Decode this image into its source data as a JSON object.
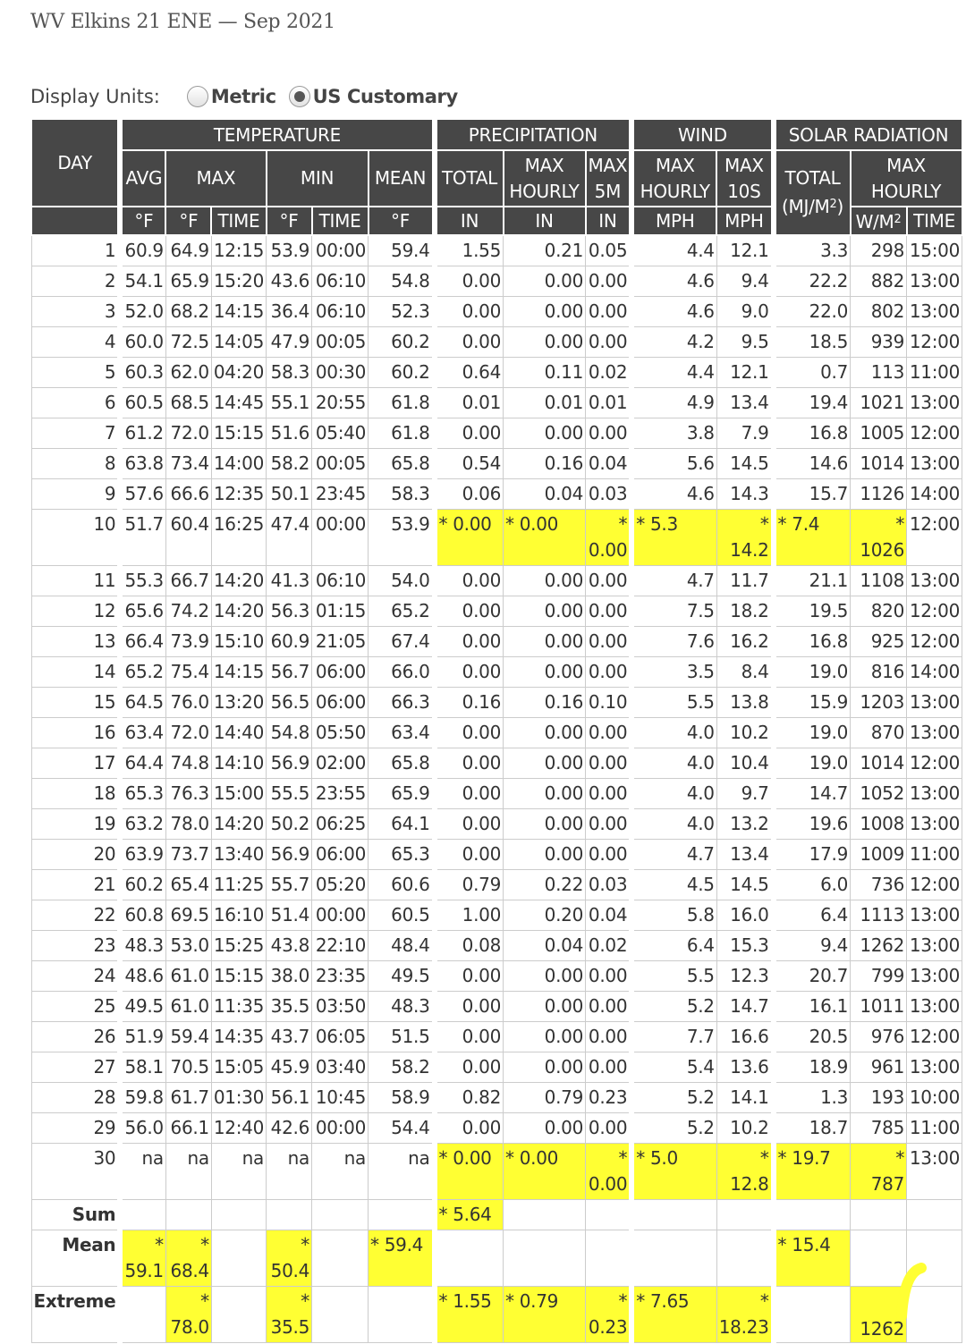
{
  "title": "WV Elkins 21 ENE — Sep 2021",
  "display_units": {
    "label": "Display Units:",
    "options": [
      "Metric",
      "US Customary"
    ],
    "selected": "US Customary"
  },
  "header": {
    "day": "DAY",
    "groups": [
      "TEMPERATURE",
      "PRECIPITATION",
      "WIND",
      "SOLAR RADIATION"
    ],
    "sub": {
      "avg": "AVG",
      "max": "MAX",
      "min": "MIN",
      "mean": "MEAN",
      "total": "TOTAL",
      "max_hourly_1": "MAX",
      "max_hourly_2": "HOURLY",
      "max5m_1": "MAX",
      "max5m_2": "5M",
      "wmax_hourly_1": "MAX",
      "wmax_hourly_2": "HOURLY",
      "max10s_1": "MAX",
      "max10s_2": "10S",
      "sol_total_1": "TOTAL",
      "sol_total_2": "(MJ/M",
      "sol_max_1": "MAX",
      "sol_max_2": "HOURLY"
    },
    "units": {
      "degf": "°F",
      "time": "TIME",
      "in": "IN",
      "mph": "MPH",
      "wm2": "W/M",
      "sup2": "2"
    }
  },
  "rows": [
    [
      "1",
      "60.9",
      "64.9",
      "12:15",
      "53.9",
      "00:00",
      "59.4",
      "1.55",
      "0.21",
      "0.05",
      "4.4",
      "12.1",
      "3.3",
      "298",
      "15:00"
    ],
    [
      "2",
      "54.1",
      "65.9",
      "15:20",
      "43.6",
      "06:10",
      "54.8",
      "0.00",
      "0.00",
      "0.00",
      "4.6",
      "9.4",
      "22.2",
      "882",
      "13:00"
    ],
    [
      "3",
      "52.0",
      "68.2",
      "14:15",
      "36.4",
      "06:10",
      "52.3",
      "0.00",
      "0.00",
      "0.00",
      "4.6",
      "9.0",
      "22.0",
      "802",
      "13:00"
    ],
    [
      "4",
      "60.0",
      "72.5",
      "14:05",
      "47.9",
      "00:05",
      "60.2",
      "0.00",
      "0.00",
      "0.00",
      "4.2",
      "9.5",
      "18.5",
      "939",
      "12:00"
    ],
    [
      "5",
      "60.3",
      "62.0",
      "04:20",
      "58.3",
      "00:30",
      "60.2",
      "0.64",
      "0.11",
      "0.02",
      "4.4",
      "12.1",
      "0.7",
      "113",
      "11:00"
    ],
    [
      "6",
      "60.5",
      "68.5",
      "14:45",
      "55.1",
      "20:55",
      "61.8",
      "0.01",
      "0.01",
      "0.01",
      "4.9",
      "13.4",
      "19.4",
      "1021",
      "13:00"
    ],
    [
      "7",
      "61.2",
      "72.0",
      "15:15",
      "51.6",
      "05:40",
      "61.8",
      "0.00",
      "0.00",
      "0.00",
      "3.8",
      "7.9",
      "16.8",
      "1005",
      "12:00"
    ],
    [
      "8",
      "63.8",
      "73.4",
      "14:00",
      "58.2",
      "00:05",
      "65.8",
      "0.54",
      "0.16",
      "0.04",
      "5.6",
      "14.5",
      "14.6",
      "1014",
      "13:00"
    ],
    [
      "9",
      "57.6",
      "66.6",
      "12:35",
      "50.1",
      "23:45",
      "58.3",
      "0.06",
      "0.04",
      "0.03",
      "4.6",
      "14.3",
      "15.7",
      "1126",
      "14:00"
    ],
    [
      "10",
      "51.7",
      "60.4",
      "16:25",
      "47.4",
      "00:00",
      "53.9",
      "* 0.00",
      "* 0.00",
      "* 0.00",
      "* 5.3",
      "* 14.2",
      "* 7.4",
      "* 1026",
      "12:00"
    ],
    [
      "11",
      "55.3",
      "66.7",
      "14:20",
      "41.3",
      "06:10",
      "54.0",
      "0.00",
      "0.00",
      "0.00",
      "4.7",
      "11.7",
      "21.1",
      "1108",
      "13:00"
    ],
    [
      "12",
      "65.6",
      "74.2",
      "14:20",
      "56.3",
      "01:15",
      "65.2",
      "0.00",
      "0.00",
      "0.00",
      "7.5",
      "18.2",
      "19.5",
      "820",
      "12:00"
    ],
    [
      "13",
      "66.4",
      "73.9",
      "15:10",
      "60.9",
      "21:05",
      "67.4",
      "0.00",
      "0.00",
      "0.00",
      "7.6",
      "16.2",
      "16.8",
      "925",
      "12:00"
    ],
    [
      "14",
      "65.2",
      "75.4",
      "14:15",
      "56.7",
      "06:00",
      "66.0",
      "0.00",
      "0.00",
      "0.00",
      "3.5",
      "8.4",
      "19.0",
      "816",
      "14:00"
    ],
    [
      "15",
      "64.5",
      "76.0",
      "13:20",
      "56.5",
      "06:00",
      "66.3",
      "0.16",
      "0.16",
      "0.10",
      "5.5",
      "13.8",
      "15.9",
      "1203",
      "13:00"
    ],
    [
      "16",
      "63.4",
      "72.0",
      "14:40",
      "54.8",
      "05:50",
      "63.4",
      "0.00",
      "0.00",
      "0.00",
      "4.0",
      "10.2",
      "19.0",
      "870",
      "13:00"
    ],
    [
      "17",
      "64.4",
      "74.8",
      "14:10",
      "56.9",
      "02:00",
      "65.8",
      "0.00",
      "0.00",
      "0.00",
      "4.0",
      "10.4",
      "19.0",
      "1014",
      "12:00"
    ],
    [
      "18",
      "65.3",
      "76.3",
      "15:00",
      "55.5",
      "23:55",
      "65.9",
      "0.00",
      "0.00",
      "0.00",
      "4.0",
      "9.7",
      "14.7",
      "1052",
      "13:00"
    ],
    [
      "19",
      "63.2",
      "78.0",
      "14:20",
      "50.2",
      "06:25",
      "64.1",
      "0.00",
      "0.00",
      "0.00",
      "4.0",
      "13.2",
      "19.6",
      "1008",
      "13:00"
    ],
    [
      "20",
      "63.9",
      "73.7",
      "13:40",
      "56.9",
      "06:00",
      "65.3",
      "0.00",
      "0.00",
      "0.00",
      "4.7",
      "13.4",
      "17.9",
      "1009",
      "11:00"
    ],
    [
      "21",
      "60.2",
      "65.4",
      "11:25",
      "55.7",
      "05:20",
      "60.6",
      "0.79",
      "0.22",
      "0.03",
      "4.5",
      "14.5",
      "6.0",
      "736",
      "12:00"
    ],
    [
      "22",
      "60.8",
      "69.5",
      "16:10",
      "51.4",
      "00:00",
      "60.5",
      "1.00",
      "0.20",
      "0.04",
      "5.8",
      "16.0",
      "6.4",
      "1113",
      "13:00"
    ],
    [
      "23",
      "48.3",
      "53.0",
      "15:25",
      "43.8",
      "22:10",
      "48.4",
      "0.08",
      "0.04",
      "0.02",
      "6.4",
      "15.3",
      "9.4",
      "1262",
      "13:00"
    ],
    [
      "24",
      "48.6",
      "61.0",
      "15:15",
      "38.0",
      "23:35",
      "49.5",
      "0.00",
      "0.00",
      "0.00",
      "5.5",
      "12.3",
      "20.7",
      "799",
      "13:00"
    ],
    [
      "25",
      "49.5",
      "61.0",
      "11:35",
      "35.5",
      "03:50",
      "48.3",
      "0.00",
      "0.00",
      "0.00",
      "5.2",
      "14.7",
      "16.1",
      "1011",
      "13:00"
    ],
    [
      "26",
      "51.9",
      "59.4",
      "14:35",
      "43.7",
      "06:05",
      "51.5",
      "0.00",
      "0.00",
      "0.00",
      "7.7",
      "16.6",
      "20.5",
      "976",
      "12:00"
    ],
    [
      "27",
      "58.1",
      "70.5",
      "15:05",
      "45.9",
      "03:40",
      "58.2",
      "0.00",
      "0.00",
      "0.00",
      "5.4",
      "13.6",
      "18.9",
      "961",
      "13:00"
    ],
    [
      "28",
      "59.8",
      "61.7",
      "01:30",
      "56.1",
      "10:45",
      "58.9",
      "0.82",
      "0.79",
      "0.23",
      "5.2",
      "14.1",
      "1.3",
      "193",
      "10:00"
    ],
    [
      "29",
      "56.0",
      "66.1",
      "12:40",
      "42.6",
      "00:00",
      "54.4",
      "0.00",
      "0.00",
      "0.00",
      "5.2",
      "10.2",
      "18.7",
      "785",
      "11:00"
    ],
    [
      "30",
      "na",
      "na",
      "na",
      "na",
      "na",
      "na",
      "* 0.00",
      "* 0.00",
      "* 0.00",
      "* 5.0",
      "* 12.8",
      "* 19.7",
      "* 787",
      "13:00"
    ]
  ],
  "highlight_rows": [
    10,
    30
  ],
  "footer": {
    "sum": {
      "label": "Sum",
      "total": "* 5.64"
    },
    "mean": {
      "label": "Mean",
      "avg": "* 59.1",
      "max": "* 68.4",
      "min": "* 50.4",
      "mean": "* 59.4",
      "sol_total": "* 15.4"
    },
    "extreme": {
      "label": "Extreme",
      "max": "* 78.0",
      "min": "* 35.5",
      "total": "* 1.55",
      "max_hourly": "* 0.79",
      "max5m": "* 0.23",
      "wmax_hourly": "* 7.65",
      "max10s": "* 18.23",
      "sol_max": "1262"
    }
  },
  "colors": {
    "header_bg": "#474747",
    "highlight": "#ffff33",
    "grid": "#cccccc"
  }
}
